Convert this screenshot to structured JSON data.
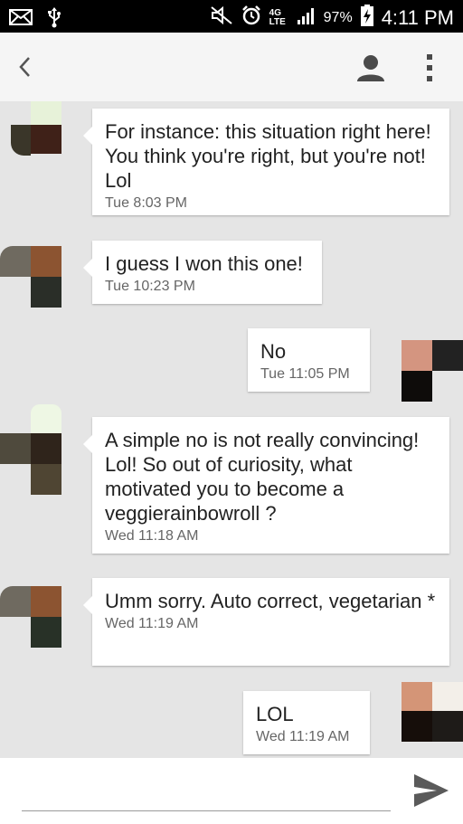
{
  "status_bar": {
    "battery": "97%",
    "time": "4:11 PM",
    "network": "4G LTE"
  },
  "icons": {
    "mail": "mail-icon",
    "usb": "usb-icon",
    "mute": "mute-icon",
    "alarm": "alarm-icon",
    "signal": "signal-icon",
    "battery": "battery-charging-icon",
    "back": "back-arrow-icon",
    "contact": "contact-icon",
    "overflow": "overflow-menu-icon",
    "send": "send-icon"
  },
  "colors": {
    "conversation_bg": "#e5e5e5",
    "bubble_bg": "#ffffff",
    "appbar_bg": "#f5f5f5"
  },
  "messages": [
    {
      "direction": "incoming",
      "text": "For instance: this situation right here! You think you're right, but you're not! Lol",
      "time": "Tue  8:03 PM"
    },
    {
      "direction": "incoming",
      "text": "I guess I won this one!",
      "time": "Tue  10:23 PM"
    },
    {
      "direction": "outgoing",
      "text": "No",
      "time": "Tue  11:05 PM"
    },
    {
      "direction": "incoming",
      "text": "A simple no is not really convincing! Lol! So out of curiosity, what motivated you to become a veggierainbowroll ?",
      "time": "Wed  11:18 AM"
    },
    {
      "direction": "incoming",
      "text": "Umm sorry. Auto correct, vegetarian *",
      "time": "Wed  11:19 AM"
    },
    {
      "direction": "outgoing",
      "text": "LOL",
      "time": "Wed  11:19 AM"
    }
  ],
  "composer": {
    "placeholder": "",
    "value": ""
  }
}
